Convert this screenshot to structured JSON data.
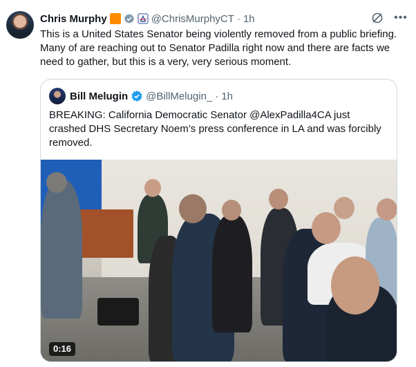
{
  "tweet": {
    "author_name": "Chris Murphy",
    "handle": "@ChrisMurphyCT",
    "separator": "·",
    "time": "1h",
    "text": "This is a United States Senator being violently removed from a public briefing. Many of are reaching out to Senator Padilla right now and there are facts we need to gather, but this is a very, very serious moment."
  },
  "quote": {
    "author_name": "Bill Melugin",
    "handle": "@BillMelugin_",
    "separator": "·",
    "time": "1h",
    "text": "BREAKING: California Democratic Senator @AlexPadilla4CA just crashed DHS Secretary Noem’s press conference in LA and was forcibly removed.",
    "video": {
      "duration": "0:16"
    }
  },
  "colors": {
    "text_primary": "#0f1419",
    "text_secondary": "#536471",
    "verified_blue": "#1d9bf0",
    "gov_gray": "#829aab",
    "border": "#cfd9de",
    "orange_badge": "#ff8a00"
  },
  "icons": {
    "grok": "grok-icon",
    "more": "more-icon",
    "verified": "verified-badge-icon",
    "government": "government-badge-icon",
    "affiliate": "affiliate-flag-icon"
  }
}
